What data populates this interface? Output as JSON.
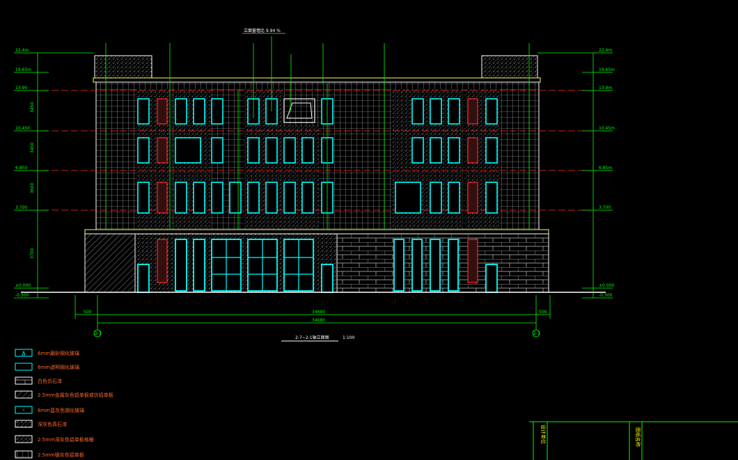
{
  "drawing": {
    "top_note": "立面窗墙比 9.94 %",
    "title": "2-7~2-1轴立面图",
    "scale": "1:100",
    "axis_left": "2-1",
    "axis_right": "2-7",
    "overall_dimension": "34680",
    "sub_dimension": "34680",
    "side_dim_left": "500",
    "side_dim_right": "500"
  },
  "elevations_left": [
    {
      "label": "22.4m"
    },
    {
      "label": "19.65m"
    },
    {
      "label": "13.90"
    },
    {
      "label": "10.450"
    },
    {
      "label": "6.850"
    },
    {
      "label": "3.700"
    },
    {
      "label": "±0.000"
    },
    {
      "label": "-0.300"
    }
  ],
  "elevations_right": [
    {
      "label": "22.4m"
    },
    {
      "label": "19.65m"
    },
    {
      "label": "13.9m"
    },
    {
      "label": "10.45m"
    },
    {
      "label": "6.85m"
    },
    {
      "label": "3.700"
    },
    {
      "label": "±0.000"
    },
    {
      "label": "-0.300"
    }
  ],
  "floor_heights": [
    "3450",
    "3450",
    "3600",
    "3700"
  ],
  "legend": [
    {
      "icon": "glass-triangle-icon",
      "text": "6mm磨砂钢化玻璃"
    },
    {
      "icon": "glass-plain-icon",
      "text": "6mm透明钢化玻璃"
    },
    {
      "icon": "stone-brick-icon",
      "text": "白色仿石漆"
    },
    {
      "icon": "hatch-diagonal-icon",
      "text": "2.5mm金属灰色铝单板或仿铝单板"
    },
    {
      "icon": "glass-dot-icon",
      "text": "6mm蓝灰色钢化玻璃"
    },
    {
      "icon": "speckle-stone-icon",
      "text": "深灰色真石漆"
    },
    {
      "icon": "hatch-cross-icon",
      "text": "2.5mm深灰色铝单板格栅"
    },
    {
      "icon": "grid-dot-icon",
      "text": "2.5mm银灰色铝单板"
    }
  ],
  "title_block": {
    "cell_a": "设计单位",
    "cell_b": "图纸名称"
  },
  "colors": {
    "background": "#000000",
    "line_white": "#ffffff",
    "line_green": "#00ff00",
    "window_cyan": "#00ffff",
    "accent_red": "#ff2a2a",
    "legend_text": "#ff6a2a",
    "title_text": "#ffff00"
  }
}
